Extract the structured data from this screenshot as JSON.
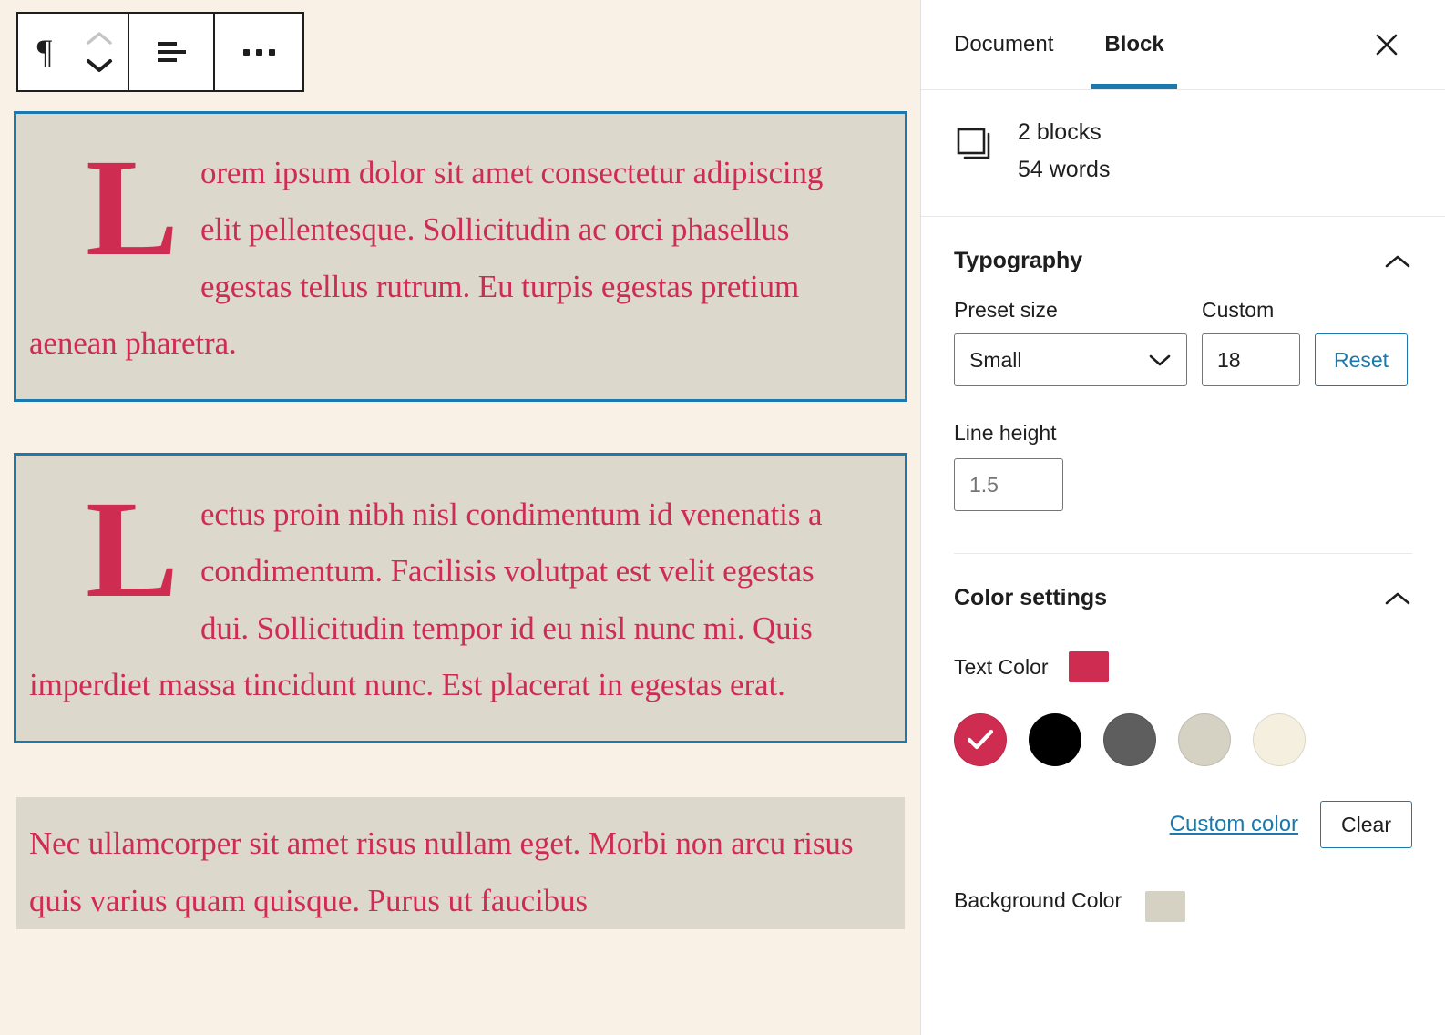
{
  "colors": {
    "canvas_bg": "#faf1e6",
    "block_bg": "#dcd8cc",
    "text_crimson": "#cf2c51",
    "selection_blue": "#1b79ad",
    "accent_blue": "#1b79ad",
    "swatch_black": "#000000",
    "swatch_grey": "#5e5e5e",
    "swatch_light": "#d5d2c4",
    "swatch_cream": "#f5efe0"
  },
  "toolbar": {
    "block_type_icon": "paragraph-pilcrow-icon",
    "pilcrow_glyph": "¶",
    "move_up_icon": "chevron-up-icon",
    "move_down_icon": "chevron-down-icon",
    "align_icon": "align-left-icon",
    "more_options_icon": "ellipsis-icon"
  },
  "content": {
    "paragraphs": [
      {
        "id": "paragraph-1",
        "selected": true,
        "dropcap": true,
        "text": "Lorem ipsum dolor sit amet consectetur adipiscing elit pellentesque. Sollicitudin ac orci phasellus egestas tellus rutrum. Eu turpis egestas pretium aenean pharetra."
      },
      {
        "id": "paragraph-2",
        "selected": true,
        "dropcap": true,
        "text": "Lectus proin nibh nisl condimentum id venenatis a condimentum. Facilisis volutpat est velit egestas dui. Sollicitudin tempor id eu nisl nunc mi. Quis imperdiet massa tincidunt nunc. Est placerat in egestas erat."
      },
      {
        "id": "paragraph-3",
        "selected": false,
        "dropcap": false,
        "text": "Nec ullamcorper sit amet risus nullam eget. Morbi non arcu risus quis varius quam quisque. Purus ut faucibus"
      }
    ]
  },
  "sidebar": {
    "tabs": [
      {
        "label": "Document",
        "active": false
      },
      {
        "label": "Block",
        "active": true
      }
    ],
    "close_icon": "close-icon",
    "block_count": {
      "icon": "copy-blocks-icon",
      "blocks": "2 blocks",
      "words": "54 words"
    },
    "typography": {
      "title": "Typography",
      "collapse_icon": "chevron-up-icon",
      "preset_label": "Preset size",
      "preset_value": "Small",
      "preset_chevron": "chevron-down-icon",
      "custom_label": "Custom",
      "custom_value": "18",
      "reset_label": "Reset",
      "line_height_label": "Line height",
      "line_height_value": "1.5"
    },
    "color_settings": {
      "title": "Color settings",
      "collapse_icon": "chevron-up-icon",
      "text_color_label": "Text Color",
      "text_color_value": "#cf2c51",
      "swatches": [
        {
          "name": "crimson",
          "hex": "#cf2c51",
          "selected": true
        },
        {
          "name": "black",
          "hex": "#000000",
          "selected": false
        },
        {
          "name": "grey",
          "hex": "#5e5e5e",
          "selected": false
        },
        {
          "name": "light-grey",
          "hex": "#d5d2c4",
          "selected": false
        },
        {
          "name": "cream",
          "hex": "#f5efe0",
          "selected": false
        }
      ],
      "custom_color_label": "Custom color",
      "clear_label": "Clear",
      "background_color_label": "Background Color",
      "background_color_value": "#d5d2c4"
    }
  }
}
